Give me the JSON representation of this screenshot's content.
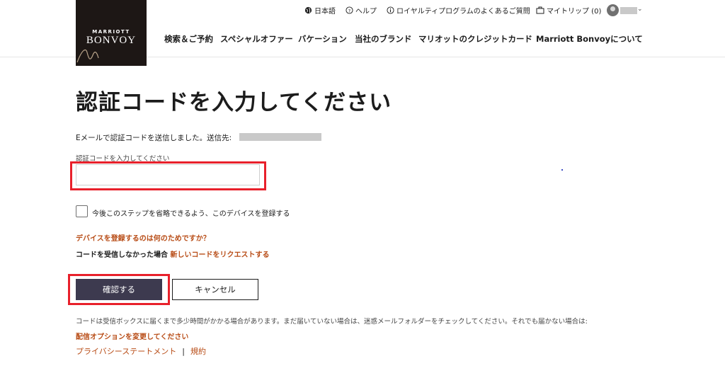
{
  "header": {
    "logo": {
      "line1": "MARRIOTT",
      "line2": "BONVOY"
    },
    "utility": {
      "language": "日本語",
      "help": "ヘルプ",
      "faq": "ロイヤルティプログラムのよくあるご質問",
      "trips": "マイトリップ (0)"
    },
    "nav": [
      "検索＆ご予約",
      "スペシャルオファー",
      "バケーション",
      "当社のブランド",
      "マリオットのクレジットカード",
      "Marriott Bonvoyについて"
    ]
  },
  "main": {
    "title": "認証コードを入力してください",
    "sent_text": "Eメールで認証コードを送信しました。送信先:",
    "code_label": "認証コードを入力してください",
    "code_value": "",
    "remember_device_label": "今後このステップを省略できるよう、このデバイスを登録する",
    "why_register_link": "デバイスを登録するのは何のためですか？",
    "not_received_text": "コードを受信しなかった場合",
    "request_new_code_link": "新しいコードをリクエストする",
    "confirm_button": "確認する",
    "cancel_button": "キャンセル",
    "note": "コードは受信ボックスに届くまで多少時間がかかる場合があります。まだ届いていない場合は、迷惑メールフォルダーをチェックしてください。それでも届かない場合は:",
    "delivery_options_link": "配信オプションを変更してください"
  },
  "footer": {
    "privacy": "プライバシーステートメント",
    "terms": "規約"
  },
  "colors": {
    "logo_bg": "#1d1715",
    "accent_link": "#b84c16",
    "primary_button": "#3d3a4f",
    "highlight": "#e8202b"
  }
}
